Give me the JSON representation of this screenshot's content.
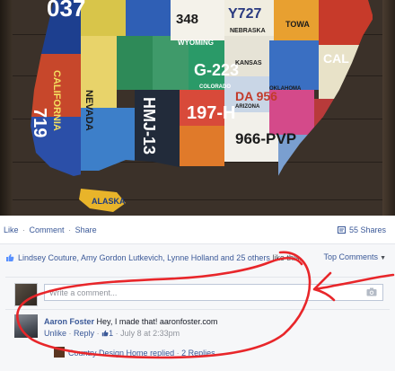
{
  "photo": {
    "description_icon": "license-plate-us-map-photo",
    "plate_texts": [
      "037",
      "348",
      "Y727",
      "WYOMING",
      "NEBRASKA",
      "G-223",
      "COLORADO",
      "ARIZONA",
      "197-H",
      "966-PVP",
      "DA 956",
      "NEVADA",
      "CALIFORNIA",
      "719",
      "ALASKA",
      "HMJ-13",
      "TOWA",
      "KANSAS",
      "OKLAHOMA",
      "CAL"
    ]
  },
  "actions": {
    "like": "Like",
    "comment": "Comment",
    "share": "Share",
    "sep": "·",
    "shares_count": "55 Shares"
  },
  "likes": {
    "names": "Lindsey Couture, Amy Gordon Lutkevich, Lynne Holland and 25 others",
    "suffix": " like this."
  },
  "sort": {
    "label": "Top Comments"
  },
  "composer": {
    "placeholder": "Write a comment..."
  },
  "comment": {
    "author": "Aaron Foster",
    "text": "Hey, I made that! aaronfoster.com",
    "unlike": "Unlike",
    "reply": "Reply",
    "like_count": "1",
    "timestamp": "July 8 at 2:33pm",
    "sep": "·"
  },
  "reply_summary": {
    "name": "Country Design Home",
    "action": "replied",
    "count": "2 Replies",
    "sep": "·"
  },
  "colors": {
    "link": "#3b5998",
    "annotation": "#e8262a",
    "feedback_bg": "#f6f7f9"
  }
}
